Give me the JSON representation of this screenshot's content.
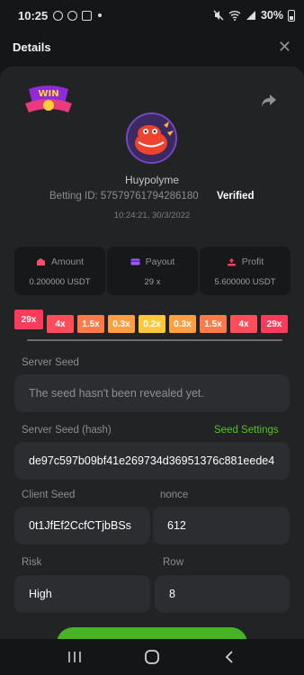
{
  "status_bar": {
    "time": "10:25",
    "battery": "30%"
  },
  "header": {
    "title": "Details"
  },
  "badge": {
    "text": "WIN"
  },
  "profile": {
    "username": "Huypolyme",
    "betting_id": "Betting ID: 57579761794286180",
    "verified": "Verified",
    "datetime": "10:24:21, 30/3/2022"
  },
  "stats": {
    "amount": {
      "label": "Amount",
      "value": "0.200000 USDT"
    },
    "payout": {
      "label": "Payout",
      "value": "29 x"
    },
    "profit": {
      "label": "Profit",
      "value": "5.600000 USDT"
    }
  },
  "multipliers": [
    {
      "label": "29x",
      "color": "#ff3b5b",
      "active": true
    },
    {
      "label": "4x",
      "color": "#ff4d5a",
      "active": false
    },
    {
      "label": "1.5x",
      "color": "#ff7a4a",
      "active": false
    },
    {
      "label": "0.3x",
      "color": "#ff9f43",
      "active": false
    },
    {
      "label": "0.2x",
      "color": "#ffc83a",
      "active": false
    },
    {
      "label": "0.3x",
      "color": "#ff9f43",
      "active": false
    },
    {
      "label": "1.5x",
      "color": "#ff7a4a",
      "active": false
    },
    {
      "label": "4x",
      "color": "#ff4d5a",
      "active": false
    },
    {
      "label": "29x",
      "color": "#ff3b5b",
      "active": false
    }
  ],
  "server_seed": {
    "label": "Server Seed",
    "placeholder": "The seed hasn't been revealed yet."
  },
  "server_seed_hash": {
    "label": "Server Seed (hash)",
    "settings_link": "Seed Settings",
    "value": "de97c597b09bf41e269734d36951376c881eede4"
  },
  "client_seed": {
    "label": "Client Seed",
    "value": "0t1JfEf2CcfCTjbBSs"
  },
  "nonce": {
    "label": "nonce",
    "value": "612"
  },
  "risk": {
    "label": "Risk",
    "value": "High"
  },
  "row": {
    "label": "Row",
    "value": "8"
  },
  "colors": {
    "accent_green": "#52c41a",
    "panel": "#222325",
    "field": "#2c2d30"
  }
}
